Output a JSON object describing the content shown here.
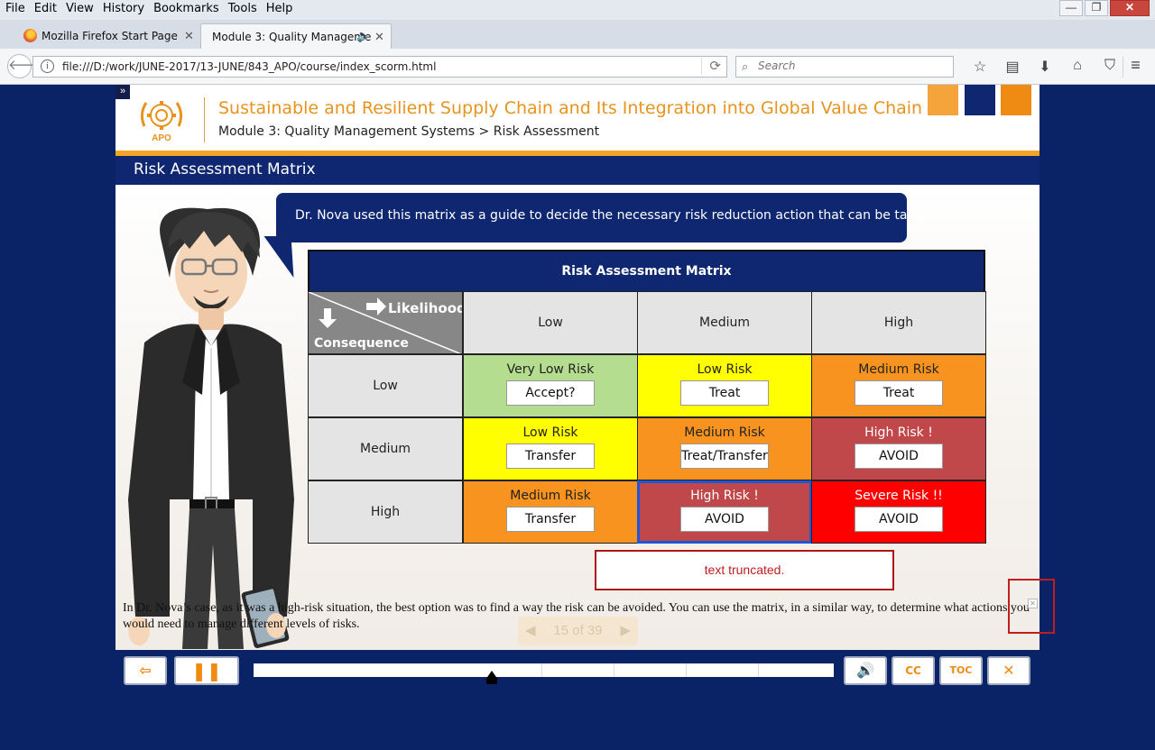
{
  "browser": {
    "menu": [
      "File",
      "Edit",
      "View",
      "History",
      "Bookmarks",
      "Tools",
      "Help"
    ],
    "window_controls": {
      "minimize": "—",
      "maximize": "❐",
      "close": "✕"
    },
    "tabs": [
      {
        "label": "Mozilla Firefox Start Page",
        "icon": "firefox-icon",
        "active": false
      },
      {
        "label": "Module 3: Quality Manageme",
        "icon": "speaker-icon",
        "active": true
      }
    ],
    "new_tab": "+",
    "url": "file:///D:/work/JUNE-2017/13-JUNE/843_APO/course/index_scorm.html",
    "search_placeholder": "Search",
    "toolbar_icons": [
      "star-icon",
      "reading-list-icon",
      "download-icon",
      "home-icon",
      "pocket-icon",
      "menu-icon"
    ]
  },
  "course": {
    "logo_text": "APO",
    "title": "Sustainable and Resilient Supply Chain and Its Integration into Global Value Chain",
    "breadcrumb": "Module 3: Quality Management Systems > Risk Assessment",
    "section_title": "Risk Assessment Matrix",
    "bubble_text": "Dr. Nova used this matrix as a guide to decide the necessary risk reduction action that can be taken.",
    "matrix": {
      "title": "Risk Assessment Matrix",
      "corner_top": "Likelihood",
      "corner_bottom": "Consequence",
      "col_headers": [
        "Low",
        "Medium",
        "High"
      ],
      "row_headers": [
        "Low",
        "Medium",
        "High"
      ],
      "cells": [
        [
          {
            "level": "Very Low Risk",
            "action": "Accept?",
            "color": "#b5dd8f",
            "text_color": "#222222"
          },
          {
            "level": "Low Risk",
            "action": "Treat",
            "color": "#ffff00",
            "text_color": "#222222"
          },
          {
            "level": "Medium Risk",
            "action": "Treat",
            "color": "#f7931e",
            "text_color": "#222222"
          }
        ],
        [
          {
            "level": "Low Risk",
            "action": "Transfer",
            "color": "#ffff00",
            "text_color": "#222222"
          },
          {
            "level": "Medium Risk",
            "action": "Treat/Transfer",
            "color": "#f7931e",
            "text_color": "#222222"
          },
          {
            "level": "High Risk !",
            "action": "AVOID",
            "color": "#c0484a",
            "text_color": "#ffffff"
          }
        ],
        [
          {
            "level": "Medium Risk",
            "action": "Transfer",
            "color": "#f7931e",
            "text_color": "#222222"
          },
          {
            "level": "High Risk !",
            "action": "AVOID",
            "color": "#c0484a",
            "text_color": "#ffffff",
            "highlighted": true
          },
          {
            "level": "Severe Risk !!",
            "action": "AVOID",
            "color": "#ff0000",
            "text_color": "#ffffff"
          }
        ]
      ]
    },
    "truncated_notice": "text truncated.",
    "narration": "In Dr. Nova’s case, as it was a high-risk situation, the best option was to find a way the risk can be avoided. You can use the matrix, in a similar way, to determine what actions you would need to manage different levels of risks.",
    "pager": {
      "text": "15 of 39",
      "prev": "◀",
      "next": "▶"
    }
  },
  "player": {
    "exit": "⇦",
    "pause": "❚❚",
    "volume": "🔊",
    "cc": "CC",
    "toc": "TOC",
    "close": "✕",
    "progress": 0.41
  },
  "colors": {
    "navy": "#0f2770",
    "page_bg": "#0a2266",
    "accent_orange": "#e7931e",
    "highlight_border": "#1e56d9"
  }
}
